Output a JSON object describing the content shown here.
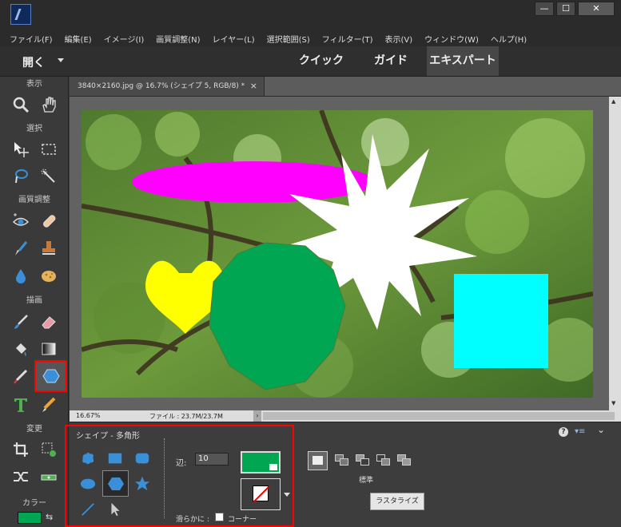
{
  "window": {
    "min": "—",
    "max": "☐",
    "close": "✕"
  },
  "menu": [
    "ファイル(F)",
    "編集(E)",
    "イメージ(I)",
    "画質調整(N)",
    "レイヤー(L)",
    "選択範囲(S)",
    "フィルター(T)",
    "表示(V)",
    "ウィンドウ(W)",
    "ヘルプ(H)"
  ],
  "mode": {
    "open": "開く",
    "tabs": [
      "クイック",
      "ガイド",
      "エキスパート"
    ]
  },
  "toolbox": {
    "view": "表示",
    "select": "選択",
    "enhance": "画質調整",
    "draw": "描画",
    "modify": "変更",
    "color": "カラー"
  },
  "document": {
    "tab": "3840×2160.jpg @ 16.7% (シェイプ 5, RGB/8) *",
    "close": "×"
  },
  "status": {
    "zoom": "16.67%",
    "file": "ファイル : 23.7M/23.7M",
    "arrow": "›"
  },
  "options": {
    "title": "シェイプ - 多角形",
    "sides_label": "辺:",
    "sides_value": "10",
    "smooth_label": "滑らかに :",
    "corner_label": "コーナー",
    "mode_label": "標準",
    "rasterize": "ラスタライズ",
    "help": "?",
    "menu": "▾≡",
    "collapse": "⌄"
  },
  "colors": {
    "fill": "#00a651",
    "highlight": "#ff0000",
    "accent_dark": "#2b2b2b"
  }
}
